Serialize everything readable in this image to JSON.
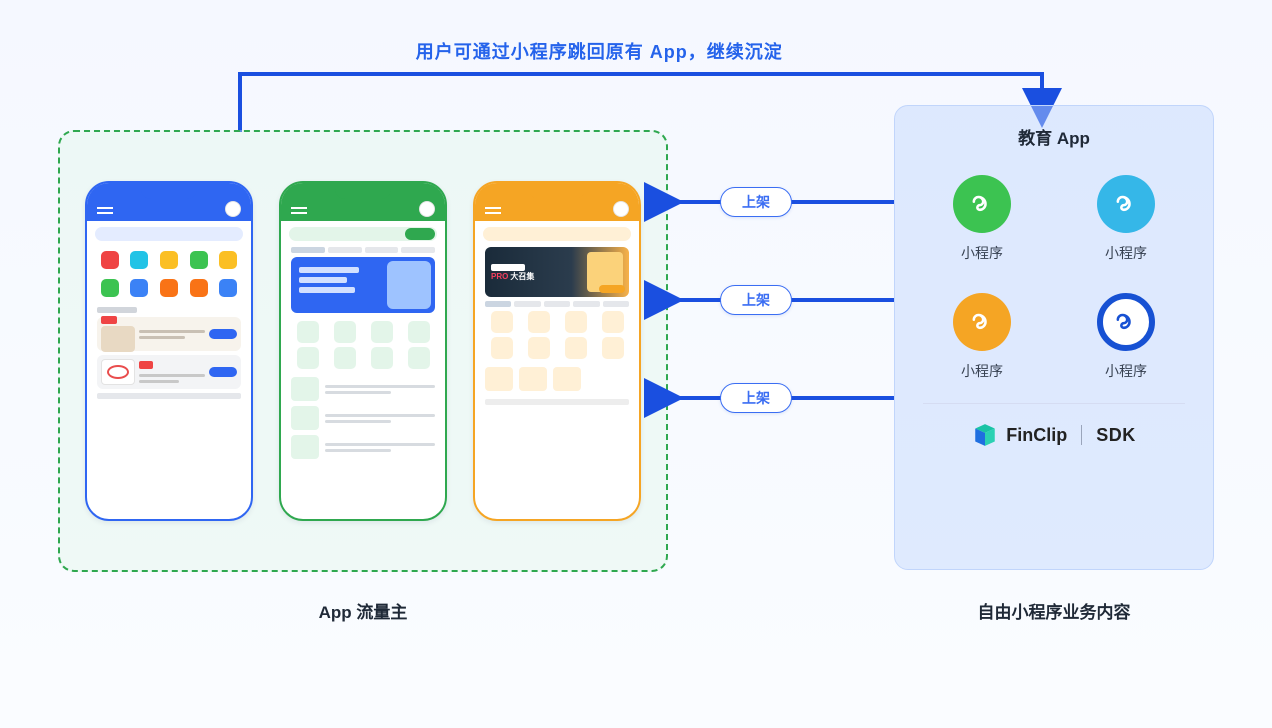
{
  "top_label": "用户可通过小程序跳回原有 App，继续沉淀",
  "left": {
    "caption": "App 流量主"
  },
  "right": {
    "title": "教育 App",
    "caption": "自由小程序业务内容",
    "miniprograms": [
      {
        "label": "小程序",
        "color": "green"
      },
      {
        "label": "小程序",
        "color": "cyan"
      },
      {
        "label": "小程序",
        "color": "orange"
      },
      {
        "label": "小程序",
        "color": "blue"
      }
    ],
    "brand": "FinClip",
    "sdk": "SDK"
  },
  "arrows": {
    "deploy": [
      "上架",
      "上架",
      "上架"
    ]
  },
  "phones": {
    "orange_hero_pro": "PRO",
    "orange_hero_tail": "大召集"
  }
}
